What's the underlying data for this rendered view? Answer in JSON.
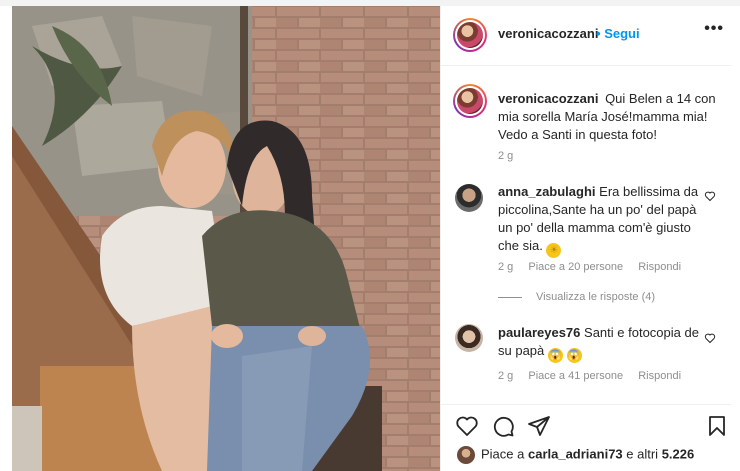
{
  "post": {
    "author": "veronicacozzani",
    "separator": "•",
    "follow_label": "Segui",
    "more_icon": "•••",
    "caption_user": "veronicacozzani",
    "caption_text": "Qui Belen a 14 con mia sorella María José!mamma mia! Vedo a Santi in questa foto!",
    "caption_time": "2 g"
  },
  "comments": [
    {
      "user": "anna_zabulaghi",
      "text": "Era bellissima da piccolina,Sante ha un po' del papà un po' della mamma com'è giusto che sia.",
      "emoji": "sun-emoji",
      "time": "2 g",
      "likes": "Piace a 20 persone",
      "reply": "Rispondi"
    },
    {
      "user": "paulareyes76",
      "text": "Santi e fotocopia de su papà",
      "emoji": "scream-emoji",
      "time": "2 g",
      "likes": "Piace a 41 persone",
      "reply": "Rispondi"
    }
  ],
  "view_replies": "Visualizza le risposte (4)",
  "likes_line": {
    "prefix": "Piace a ",
    "user": "carla_adriani73",
    "suffix": " e altri ",
    "count": "5.226"
  },
  "colors": {
    "follow": "#0095f6",
    "muted": "#8e8e8e",
    "text": "#262626"
  }
}
